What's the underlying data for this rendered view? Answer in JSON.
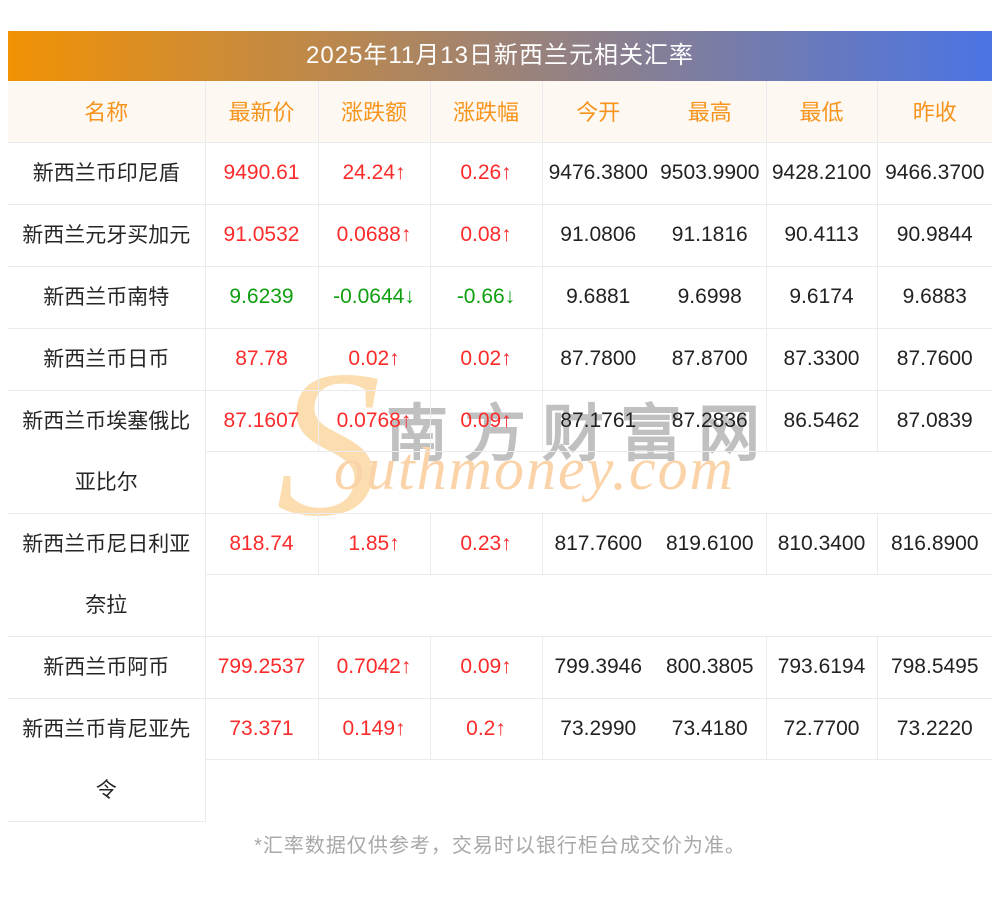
{
  "page": {
    "title": "2025年11月13日新西兰元相关汇率",
    "footnote": "*汇率数据仅供参考，交易时以银行柜台成交价为准。"
  },
  "watermark": {
    "s_glyph": "S",
    "cn_text": "南方财富网",
    "en_text": "outhmoney.com"
  },
  "colors": {
    "title_gradient_left": "#f29204",
    "title_gradient_right": "#4b74e4",
    "header_text": "#f7941d",
    "header_bg": "#fdf8f1",
    "up": "#fb2b2b",
    "down": "#0f9e0f",
    "border": "#e9ebee"
  },
  "table": {
    "columns": [
      "名称",
      "最新价",
      "涨跌额",
      "涨跌幅",
      "今开",
      "最高",
      "最低",
      "昨收"
    ],
    "rows": [
      {
        "name_lines": [
          "新西兰币印尼盾"
        ],
        "latest": "9490.61",
        "change": "24.24↑",
        "pct": "0.26↑",
        "open": "9476.3800",
        "high": "9503.9900",
        "low": "9428.2100",
        "prev": "9466.3700",
        "trend": "up"
      },
      {
        "name_lines": [
          "新西兰元牙买加元"
        ],
        "latest": "91.0532",
        "change": "0.0688↑",
        "pct": "0.08↑",
        "open": "91.0806",
        "high": "91.1816",
        "low": "90.4113",
        "prev": "90.9844",
        "trend": "up"
      },
      {
        "name_lines": [
          "新西兰币南特"
        ],
        "latest": "9.6239",
        "change": "-0.0644↓",
        "pct": "-0.66↓",
        "open": "9.6881",
        "high": "9.6998",
        "low": "9.6174",
        "prev": "9.6883",
        "trend": "down"
      },
      {
        "name_lines": [
          "新西兰币日币"
        ],
        "latest": "87.78",
        "change": "0.02↑",
        "pct": "0.02↑",
        "open": "87.7800",
        "high": "87.8700",
        "low": "87.3300",
        "prev": "87.7600",
        "trend": "up"
      },
      {
        "name_lines": [
          "新西兰币埃塞俄比",
          "亚比尔"
        ],
        "latest": "87.1607",
        "change": "0.0768↑",
        "pct": "0.09↑",
        "open": "87.1761",
        "high": "87.2836",
        "low": "86.5462",
        "prev": "87.0839",
        "trend": "up"
      },
      {
        "name_lines": [
          "新西兰币尼日利亚",
          "奈拉"
        ],
        "latest": "818.74",
        "change": "1.85↑",
        "pct": "0.23↑",
        "open": "817.7600",
        "high": "819.6100",
        "low": "810.3400",
        "prev": "816.8900",
        "trend": "up"
      },
      {
        "name_lines": [
          "新西兰币阿币"
        ],
        "latest": "799.2537",
        "change": "0.7042↑",
        "pct": "0.09↑",
        "open": "799.3946",
        "high": "800.3805",
        "low": "793.6194",
        "prev": "798.5495",
        "trend": "up"
      },
      {
        "name_lines": [
          "新西兰币肯尼亚先",
          "令"
        ],
        "latest": "73.371",
        "change": "0.149↑",
        "pct": "0.2↑",
        "open": "73.2990",
        "high": "73.4180",
        "low": "72.7700",
        "prev": "73.2220",
        "trend": "up"
      }
    ]
  }
}
